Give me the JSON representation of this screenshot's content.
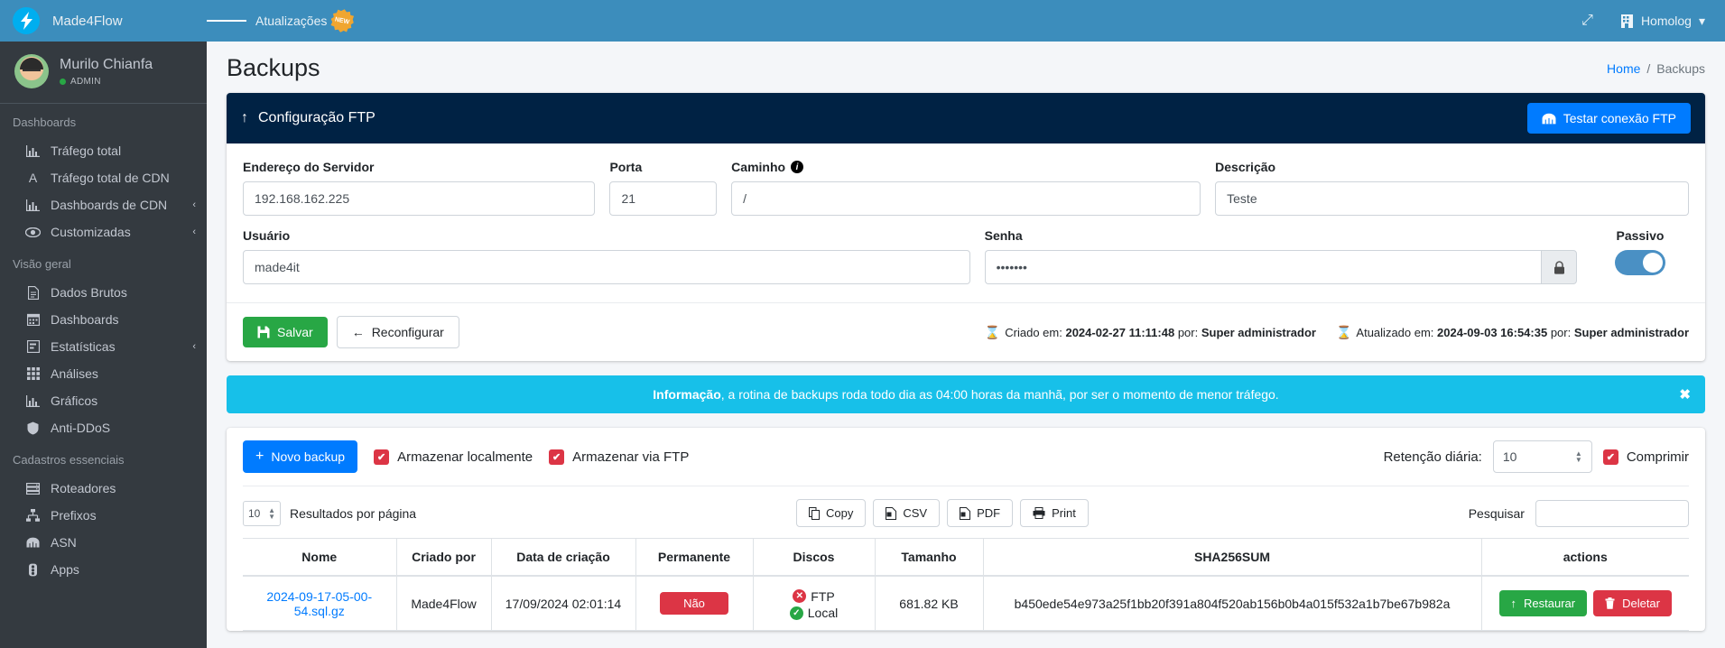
{
  "brand": {
    "name": "Made4Flow",
    "logo_glyph": "↯"
  },
  "topbar": {
    "menu_toggle": "hamburger-icon",
    "updates_label": "Atualizações",
    "new_badge": "NEW",
    "fullscreen_icon": "⤢",
    "env_label": "Homolog",
    "env_icon": "🏢",
    "caret": "▾"
  },
  "sidebar": {
    "user": {
      "name": "Murilo Chianfa",
      "role": "ADMIN"
    },
    "groups": [
      {
        "header": "Dashboards",
        "items": [
          {
            "label": "Tráfego total",
            "icon": "Ὄa",
            "glyph": "╣",
            "has_chevron": false
          },
          {
            "label": "Tráfego total de CDN",
            "glyph": "A",
            "has_chevron": false
          },
          {
            "label": "Dashboards de CDN",
            "glyph": "╣",
            "has_chevron": true
          },
          {
            "label": "Customizadas",
            "glyph": "◉",
            "has_chevron": true
          }
        ]
      },
      {
        "header": "Visão geral",
        "items": [
          {
            "label": "Dados Brutos",
            "glyph": "☰",
            "has_chevron": false
          },
          {
            "label": "Dashboards",
            "glyph": "▦",
            "has_chevron": false
          },
          {
            "label": "Estatísticas",
            "glyph": "▤",
            "has_chevron": true
          },
          {
            "label": "Análises",
            "glyph": "▒",
            "has_chevron": false
          },
          {
            "label": "Gráficos",
            "glyph": "╣",
            "has_chevron": false
          },
          {
            "label": "Anti-DDoS",
            "glyph": "⛨",
            "has_chevron": false
          }
        ]
      },
      {
        "header": "Cadastros essenciais",
        "items": [
          {
            "label": "Roteadores",
            "glyph": "≡",
            "has_chevron": false
          },
          {
            "label": "Prefixos",
            "glyph": "⛓",
            "has_chevron": false
          },
          {
            "label": "ASN",
            "glyph": "☷",
            "has_chevron": false
          },
          {
            "label": "Apps",
            "glyph": "✇",
            "has_chevron": false
          }
        ]
      }
    ]
  },
  "page": {
    "title": "Backups",
    "breadcrumb": {
      "home": "Home",
      "sep": "/",
      "current": "Backups"
    }
  },
  "ftp_card": {
    "title": "Configuração FTP",
    "title_icon": "↑",
    "test_button": "Testar conexão FTP",
    "test_button_icon": "network-icon",
    "fields": {
      "server": {
        "label": "Endereço do Servidor",
        "value": "192.168.162.225"
      },
      "port": {
        "label": "Porta",
        "value": "21"
      },
      "path": {
        "label": "Caminho",
        "value": "/",
        "info": "i"
      },
      "description": {
        "label": "Descrição",
        "value": "Teste"
      },
      "user": {
        "label": "Usuário",
        "value": "made4it"
      },
      "password": {
        "label": "Senha",
        "value": "•••••••",
        "lock_icon": "🔒"
      },
      "passive": {
        "label": "Passivo",
        "on": true
      }
    },
    "save_button": "Salvar",
    "save_icon": "💾",
    "reconfig_button": "Reconfigurar",
    "reconfig_icon": "←",
    "meta": {
      "created_prefix": "Criado em:",
      "created_date": "2024-02-27 11:11:48",
      "created_by_prefix": "por:",
      "created_by": "Super administrador",
      "updated_prefix": "Atualizado em:",
      "updated_date": "2024-09-03 16:54:35",
      "updated_by_prefix": "por:",
      "updated_by": "Super administrador",
      "icon": "⌛"
    }
  },
  "alert": {
    "bold": "Informação",
    "text": ", a rotina de backups roda todo dia as 04:00 horas da manhã, por ser o momento de menor tráfego.",
    "close": "✖"
  },
  "backups_toolbar": {
    "new_button": "Novo backup",
    "new_icon": "+",
    "store_local": {
      "label": "Armazenar localmente",
      "checked": true
    },
    "store_ftp": {
      "label": "Armazenar via FTP",
      "checked": true
    },
    "retention_label": "Retenção diária:",
    "retention_value": "10",
    "compress": {
      "label": "Comprimir",
      "checked": true
    },
    "check_glyph": "✔"
  },
  "table_tools": {
    "per_page_value": "10",
    "per_page_label": "Resultados por página",
    "export": [
      {
        "label": "Copy",
        "icon": "❐"
      },
      {
        "label": "CSV",
        "icon": "▤"
      },
      {
        "label": "PDF",
        "icon": "▤"
      },
      {
        "label": "Print",
        "icon": "⎙"
      }
    ],
    "search_label": "Pesquisar",
    "search_value": ""
  },
  "table": {
    "columns": [
      "Nome",
      "Criado por",
      "Data de criação",
      "Permanente",
      "Discos",
      "Tamanho",
      "SHA256SUM",
      "actions"
    ],
    "rows": [
      {
        "nome": "2024-09-17-05-00-54.sql.gz",
        "criado_por": "Made4Flow",
        "data": "17/09/2024 02:01:14",
        "permanente": "Não",
        "discos": {
          "ftp_label": "FTP",
          "ftp_ok": false,
          "local_label": "Local",
          "local_ok": true
        },
        "tamanho": "681.82 KB",
        "sha": "b450ede54e973a25f1bb20f391a804f520ab156b0b4a015f532a1b7be67b982a",
        "actions": {
          "restore": "Restaurar",
          "restore_icon": "↑",
          "delete": "Deletar",
          "delete_icon": "🗑"
        }
      }
    ]
  },
  "colors": {
    "topbar": "#3c8dbc",
    "sidebar": "#343a40",
    "card_head": "#002244",
    "primary": "#007bff",
    "success": "#28a745",
    "danger": "#dc3545",
    "info": "#17c0e9"
  }
}
